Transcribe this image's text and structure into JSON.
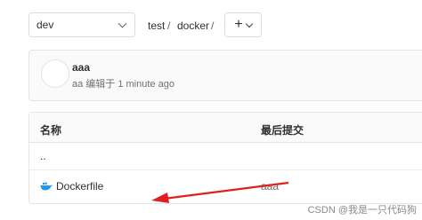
{
  "branch": {
    "value": "dev"
  },
  "breadcrumb": {
    "items": [
      "test",
      "docker"
    ],
    "separator": "/"
  },
  "add_button": {
    "label": "+"
  },
  "commit": {
    "title": "aaa",
    "meta": "aa 编辑于 1 minute ago"
  },
  "table": {
    "columns": [
      "名称",
      "最后提交"
    ],
    "rows": [
      {
        "name": "..",
        "last_commit": ""
      },
      {
        "name": "Dockerfile",
        "last_commit": "aaa",
        "icon": "docker-whale-icon"
      }
    ]
  },
  "watermark": "CSDN @我是一只代码狗",
  "colors": {
    "annotation_arrow": "#e02020",
    "docker_blue": "#2496ed"
  }
}
